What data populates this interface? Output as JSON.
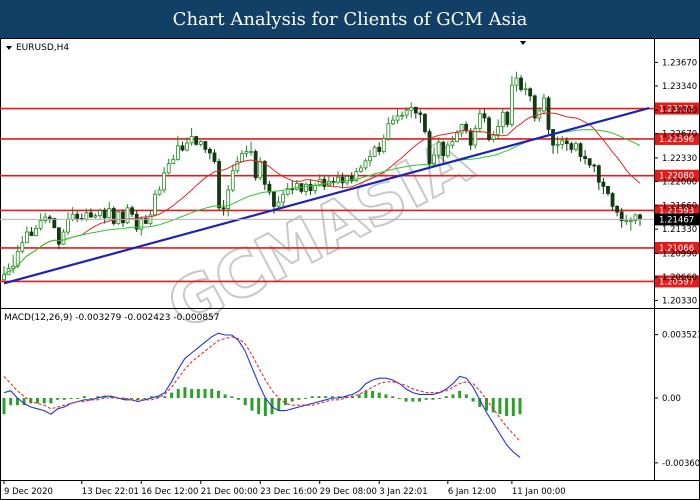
{
  "banner": {
    "title": "Chart Analysis for Clients of GCM Asia"
  },
  "watermark": "GCMASIA",
  "chart_data": {
    "type": "candlestick",
    "symbol_label": "EURUSD,H4",
    "price_axis": {
      "range": [
        1.2028,
        1.2376
      ],
      "ticks": [
        "1.23670",
        "1.23340",
        "1.23000",
        "1.22670",
        "1.22330",
        "1.22000",
        "1.21660",
        "1.21330",
        "1.20990",
        "1.20660",
        "1.20330"
      ]
    },
    "current_price": "1.21467",
    "levels": [
      {
        "label": "1.23023",
        "value": 1.23023
      },
      {
        "label": "1.22596",
        "value": 1.22596
      },
      {
        "label": "1.22080",
        "value": 1.2208
      },
      {
        "label": "1.21593",
        "value": 1.21593
      },
      {
        "label": "1.21066",
        "value": 1.21066
      },
      {
        "label": "1.20597",
        "value": 1.20597
      }
    ],
    "trendline": {
      "from": {
        "bar": 0,
        "price": 1.2057
      },
      "to": {
        "bar": 141,
        "price": 1.2303
      }
    },
    "closes": [
      1.2069,
      1.2078,
      1.2081,
      1.2102,
      1.2114,
      1.2129,
      1.2124,
      1.2134,
      1.2145,
      1.215,
      1.2148,
      1.2135,
      1.2112,
      1.2129,
      1.2147,
      1.2154,
      1.2148,
      1.2147,
      1.2156,
      1.215,
      1.2152,
      1.2159,
      1.2149,
      1.2162,
      1.2141,
      1.2157,
      1.2142,
      1.2163,
      1.2154,
      1.2133,
      1.2148,
      1.2141,
      1.2153,
      1.2182,
      1.2188,
      1.2212,
      1.2225,
      1.2231,
      1.225,
      1.2244,
      1.2254,
      1.2263,
      1.2252,
      1.2256,
      1.2245,
      1.224,
      1.2228,
      1.2163,
      1.2162,
      1.2188,
      1.2215,
      1.2228,
      1.2239,
      1.2242,
      1.2242,
      1.2205,
      1.2228,
      1.2196,
      1.2185,
      1.2165,
      1.2171,
      1.2182,
      1.219,
      1.2189,
      1.2197,
      1.2186,
      1.2196,
      1.2187,
      1.2194,
      1.2203,
      1.2193,
      1.22,
      1.2199,
      1.2206,
      1.2198,
      1.2207,
      1.2201,
      1.2214,
      1.2219,
      1.2229,
      1.2235,
      1.2248,
      1.2242,
      1.226,
      1.2281,
      1.2286,
      1.2292,
      1.2293,
      1.23,
      1.2304,
      1.2296,
      1.2294,
      1.227,
      1.2225,
      1.2237,
      1.2255,
      1.2236,
      1.2251,
      1.2256,
      1.2268,
      1.228,
      1.2271,
      1.2251,
      1.2274,
      1.2295,
      1.2289,
      1.2259,
      1.2266,
      1.2277,
      1.2297,
      1.228,
      1.2335,
      1.2345,
      1.2329,
      1.233,
      1.232,
      1.2289,
      1.2299,
      1.2317,
      1.2273,
      1.2251,
      1.2252,
      1.2257,
      1.2253,
      1.2245,
      1.2253,
      1.2235,
      1.2232,
      1.2223,
      1.2222,
      1.2199,
      1.2193,
      1.2183,
      1.2165,
      1.2157,
      1.2145,
      1.2145,
      1.2145,
      1.2153,
      1.2147
    ],
    "highs": [
      1.2081,
      1.2085,
      1.2097,
      1.2111,
      1.2123,
      1.2137,
      1.2136,
      1.2139,
      1.2155,
      1.2156,
      1.2153,
      1.2149,
      1.213,
      1.2133,
      1.2157,
      1.2164,
      1.2158,
      1.2155,
      1.2162,
      1.2162,
      1.2155,
      1.2162,
      1.2163,
      1.2171,
      1.2165,
      1.2158,
      1.2161,
      1.2168,
      1.2166,
      1.2159,
      1.2151,
      1.2153,
      1.216,
      1.2188,
      1.2193,
      1.222,
      1.2232,
      1.2238,
      1.2264,
      1.2256,
      1.2262,
      1.2275,
      1.2264,
      1.2258,
      1.2255,
      1.2248,
      1.2245,
      1.2232,
      1.2174,
      1.2195,
      1.2224,
      1.2235,
      1.2244,
      1.225,
      1.2256,
      1.2245,
      1.2234,
      1.223,
      1.2201,
      1.2186,
      1.2179,
      1.2188,
      1.2198,
      1.2201,
      1.2202,
      1.2196,
      1.2199,
      1.2202,
      1.2198,
      1.221,
      1.2207,
      1.2207,
      1.2206,
      1.2214,
      1.2212,
      1.221,
      1.2213,
      1.2219,
      1.2223,
      1.2232,
      1.2244,
      1.2251,
      1.2255,
      1.2266,
      1.229,
      1.2293,
      1.2301,
      1.2298,
      1.2304,
      1.2311,
      1.2305,
      1.23,
      1.2296,
      1.2274,
      1.2248,
      1.2262,
      1.2257,
      1.2256,
      1.2264,
      1.2272,
      1.2281,
      1.2284,
      1.2275,
      1.2279,
      1.2301,
      1.2302,
      1.2292,
      1.2271,
      1.2287,
      1.2303,
      1.2299,
      1.2348,
      1.2354,
      1.2349,
      1.2339,
      1.2332,
      1.2322,
      1.2304,
      1.2323,
      1.232,
      1.2273,
      1.2263,
      1.2264,
      1.2262,
      1.2256,
      1.2256,
      1.2255,
      1.2244,
      1.2229,
      1.2225,
      1.2224,
      1.2205,
      1.2191,
      1.2185,
      1.2167,
      1.2163,
      1.2153,
      1.215,
      1.2155,
      1.2155
    ],
    "lows": [
      1.2061,
      1.2069,
      1.2071,
      1.2078,
      1.2099,
      1.2114,
      1.2124,
      1.2123,
      1.2131,
      1.2141,
      1.2142,
      1.2135,
      1.2105,
      1.2111,
      1.2125,
      1.2144,
      1.2143,
      1.2145,
      1.2144,
      1.2149,
      1.2148,
      1.2148,
      1.2141,
      1.2148,
      1.2138,
      1.2139,
      1.2136,
      1.214,
      1.215,
      1.2129,
      1.2124,
      1.2141,
      1.2138,
      1.2151,
      1.218,
      1.2184,
      1.221,
      1.2224,
      1.2229,
      1.2242,
      1.2242,
      1.225,
      1.225,
      1.2249,
      1.224,
      1.2231,
      1.2225,
      1.2159,
      1.2152,
      1.2151,
      1.2185,
      1.2211,
      1.2227,
      1.2234,
      1.2236,
      1.2201,
      1.2202,
      1.2188,
      1.2181,
      1.2155,
      1.2161,
      1.2164,
      1.218,
      1.2182,
      1.2187,
      1.2183,
      1.218,
      1.2181,
      1.2182,
      1.2193,
      1.2188,
      1.2192,
      1.2194,
      1.2196,
      1.2191,
      1.2194,
      1.2197,
      1.2199,
      1.2212,
      1.2216,
      1.2221,
      1.2234,
      1.2237,
      1.2239,
      1.2257,
      1.2279,
      1.2281,
      1.2286,
      1.2288,
      1.2289,
      1.2288,
      1.2282,
      1.2267,
      1.2218,
      1.2222,
      1.2232,
      1.2226,
      1.2233,
      1.2246,
      1.2255,
      1.2262,
      1.2267,
      1.2244,
      1.2246,
      1.2268,
      1.2283,
      1.2256,
      1.2255,
      1.2258,
      1.2267,
      1.2276,
      1.2276,
      1.2326,
      1.2326,
      1.2321,
      1.2312,
      1.2284,
      1.2284,
      1.2294,
      1.2266,
      1.2239,
      1.2239,
      1.2245,
      1.2243,
      1.224,
      1.2242,
      1.2228,
      1.2224,
      1.2219,
      1.2213,
      1.2188,
      1.2182,
      1.218,
      1.2159,
      1.2151,
      1.2135,
      1.2139,
      1.2131,
      1.214,
      1.2138
    ],
    "x_labels": [
      {
        "bar": 0,
        "label": "9 Dec 2020"
      },
      {
        "bar": 17,
        "label": "13 Dec 22:01"
      },
      {
        "bar": 30,
        "label": "16 Dec 12:00"
      },
      {
        "bar": 43,
        "label": "21 Dec 00:00"
      },
      {
        "bar": 56,
        "label": "23 Dec 16:00"
      },
      {
        "bar": 69,
        "label": "29 Dec 08:00"
      },
      {
        "bar": 82,
        "label": "3 Jan 22:01"
      },
      {
        "bar": 97,
        "label": "6 Jan 12:00"
      },
      {
        "bar": 111,
        "label": "11 Jan 00:00"
      }
    ],
    "macd": {
      "label": "MACD(12,26,9) -0.003279 -0.002423 -0.000857",
      "range": [
        -0.004,
        0.004
      ],
      "ticks": [
        "0.003521",
        "0.00",
        "-0.003603"
      ],
      "macd_line": [
        0.0003,
        0.0004,
        0.0,
        -0.0003,
        -0.0005,
        -0.0006,
        -0.0007,
        -0.0009,
        -0.0006,
        -0.0005,
        -0.0003,
        -0.0002,
        -0.0001,
        -0.0001,
        0.0,
        0.0001,
        0.0001,
        0.0,
        -0.0001,
        -0.0001,
        -0.0002,
        -0.0001,
        0.0,
        0.0001,
        0.0003,
        0.0009,
        0.0016,
        0.0022,
        0.0025,
        0.0028,
        0.0031,
        0.0034,
        0.0036,
        0.0035,
        0.0035,
        0.0032,
        0.0026,
        0.0017,
        0.0008,
        0.0,
        -0.0005,
        -0.0007,
        -0.0007,
        -0.0006,
        -0.0005,
        -0.0004,
        -0.0003,
        -0.0002,
        -0.0001,
        0.0,
        0.0,
        0.0001,
        0.0002,
        0.0004,
        0.0008,
        0.001,
        0.0011,
        0.0011,
        0.001,
        0.0008,
        0.0005,
        0.0003,
        0.0002,
        0.0002,
        0.0002,
        0.0003,
        0.0005,
        0.0008,
        0.0012,
        0.0011,
        0.0006,
        -0.0001,
        -0.0008,
        -0.0014,
        -0.002,
        -0.0026,
        -0.003,
        -0.0033
      ],
      "signal_line": [
        0.0012,
        0.0008,
        0.0004,
        0.0001,
        -0.0002,
        -0.0003,
        -0.0004,
        -0.0006,
        -0.0005,
        -0.0004,
        -0.0003,
        -0.0002,
        -0.0002,
        -0.0001,
        -0.0001,
        0.0,
        0.0,
        0.0,
        0.0,
        -0.0001,
        -0.0001,
        -0.0001,
        -0.0001,
        0.0,
        0.0002,
        0.0006,
        0.0011,
        0.0016,
        0.002,
        0.0023,
        0.0026,
        0.0029,
        0.0032,
        0.0033,
        0.0034,
        0.0033,
        0.003,
        0.0024,
        0.0017,
        0.001,
        0.0004,
        0.0,
        -0.0003,
        -0.0004,
        -0.0004,
        -0.0004,
        -0.0004,
        -0.0003,
        -0.0002,
        -0.0001,
        -0.0001,
        0.0,
        0.0001,
        0.0002,
        0.0004,
        0.0006,
        0.0008,
        0.0009,
        0.0009,
        0.0008,
        0.0007,
        0.0005,
        0.0004,
        0.0003,
        0.0003,
        0.0003,
        0.0004,
        0.0006,
        0.0008,
        0.0009,
        0.0008,
        0.0004,
        -0.0001,
        -0.0006,
        -0.0011,
        -0.0016,
        -0.002,
        -0.0024
      ],
      "histogram": [
        -0.0009,
        -0.0004,
        -0.0004,
        -0.0004,
        -0.0003,
        -0.0003,
        -0.0003,
        -0.0003,
        -0.0001,
        -0.0001,
        0.0,
        0.0,
        0.0001,
        0.0,
        0.0001,
        0.0001,
        0.0001,
        0.0,
        -0.0001,
        0.0,
        -0.0001,
        0.0,
        0.0001,
        0.0001,
        0.0001,
        0.0003,
        0.0005,
        0.0006,
        0.0005,
        0.0005,
        0.0005,
        0.0005,
        0.0004,
        0.0002,
        0.0001,
        -0.0001,
        -0.0004,
        -0.0007,
        -0.0009,
        -0.001,
        -0.0009,
        -0.0007,
        -0.0004,
        -0.0002,
        -0.0001,
        0.0,
        0.0001,
        0.0001,
        0.0001,
        0.0001,
        0.0001,
        0.0001,
        0.0001,
        0.0002,
        0.0004,
        0.0004,
        0.0003,
        0.0002,
        0.0001,
        0.0,
        -0.0002,
        -0.0002,
        -0.0002,
        -0.0001,
        -0.0001,
        0.0,
        0.0001,
        0.0002,
        0.0004,
        0.0002,
        -0.0002,
        -0.0005,
        -0.0007,
        -0.0008,
        -0.0009,
        -0.001,
        -0.001,
        -0.0009
      ]
    },
    "colors": {
      "bull_candle": "#1f8b1f",
      "bear_candle": "#123a12",
      "level_line": "#e31b1b",
      "level_box": "#e31b1b",
      "trendline": "#1b23b8",
      "ma_fast": "#e02626",
      "ma_slow": "#2ec72e",
      "macd_line": "#2435d6",
      "signal_line": "#e03030",
      "histogram": "#2aa02a",
      "current_box": "#000000",
      "banner_bg": "#123f66"
    }
  }
}
